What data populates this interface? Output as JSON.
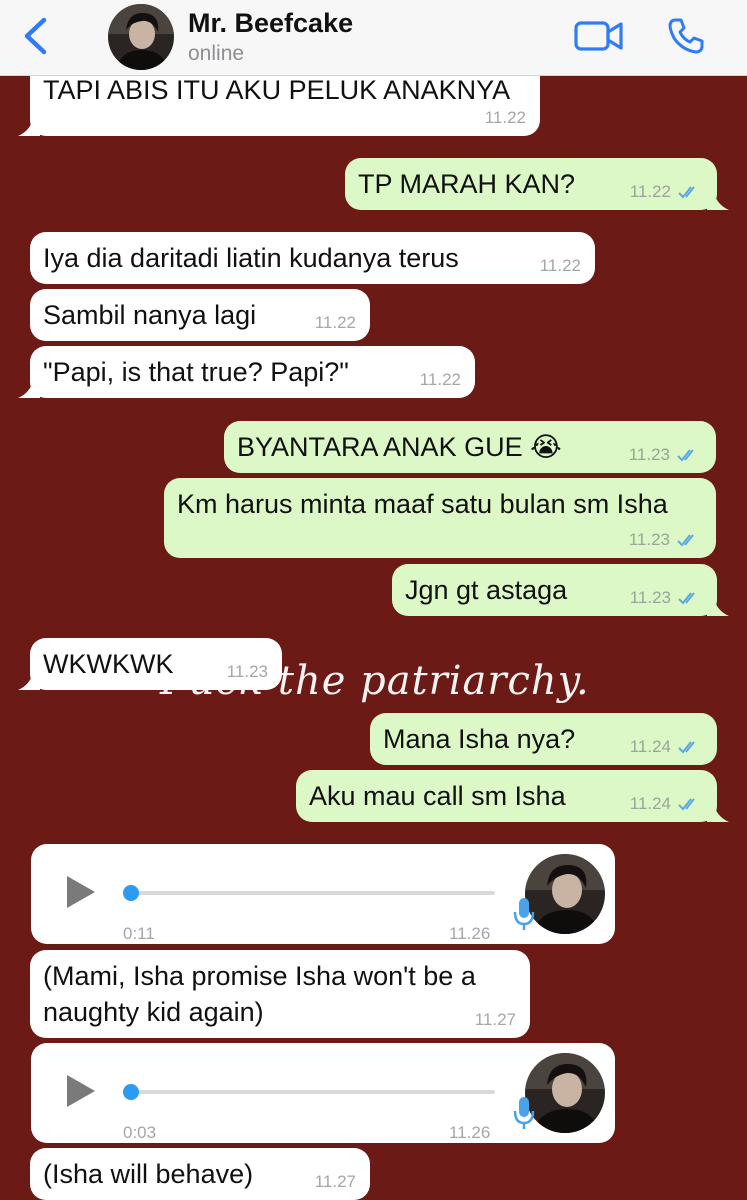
{
  "header": {
    "contact_name": "Mr. Beefcake",
    "status": "online",
    "icons": [
      "chevron-left-icon",
      "avatar",
      "video-call-icon",
      "phone-icon"
    ],
    "accent_color": "#2f7cf6"
  },
  "watermark": "Fuck the patriarchy.",
  "colors": {
    "background": "#6b1a16",
    "incoming": "#ffffff",
    "outgoing": "#dcf8c6",
    "read_ticks": "#5aa9e6"
  },
  "messages": [
    {
      "dir": "in",
      "text": "TAPI ABIS ITU AKU PELUK ANAKNYA",
      "time": "11.22"
    },
    {
      "dir": "out",
      "text": "TP MARAH KAN?",
      "time": "11.22"
    },
    {
      "dir": "in",
      "text": "Iya dia daritadi liatin kudanya terus",
      "time": "11.22"
    },
    {
      "dir": "in",
      "text": "Sambil nanya lagi",
      "time": "11.22"
    },
    {
      "dir": "in",
      "text": "\"Papi, is that true? Papi?\"",
      "time": "11.22"
    },
    {
      "dir": "out",
      "text": "BYANTARA ANAK GUE 😭",
      "time": "11.23"
    },
    {
      "dir": "out",
      "text": "Km harus minta maaf satu bulan sm Isha",
      "time": "11.23"
    },
    {
      "dir": "out",
      "text": "Jgn gt astaga",
      "time": "11.23"
    },
    {
      "dir": "in",
      "text": "WKWKWK",
      "time": "11.23"
    },
    {
      "dir": "out",
      "text": "Mana Isha nya?",
      "time": "11.24"
    },
    {
      "dir": "out",
      "text": "Aku mau call sm Isha",
      "time": "11.24"
    },
    {
      "dir": "in",
      "type": "voice",
      "duration": "0:11",
      "time": "11.26"
    },
    {
      "dir": "in",
      "text_lines": [
        "(Mami, Isha promise Isha won't be a",
        "naughty kid again)"
      ],
      "time": "11.27"
    },
    {
      "dir": "in",
      "type": "voice",
      "duration": "0:03",
      "time": "11.26"
    },
    {
      "dir": "in",
      "text": "(Isha will behave)",
      "time": "11.27"
    }
  ]
}
